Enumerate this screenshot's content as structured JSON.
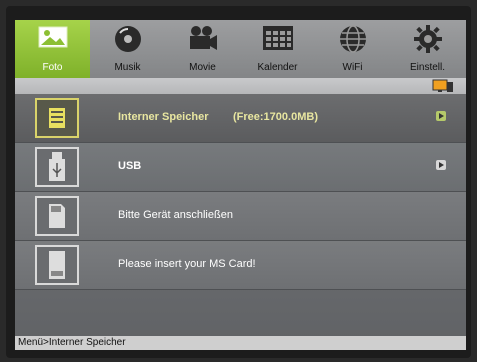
{
  "tabs": [
    {
      "label": "Foto",
      "icon": "photo-icon",
      "active": true
    },
    {
      "label": "Musik",
      "icon": "music-disc-icon"
    },
    {
      "label": "Movie",
      "icon": "movie-camera-icon"
    },
    {
      "label": "Kalender",
      "icon": "calendar-icon"
    },
    {
      "label": "WiFi",
      "icon": "globe-icon"
    },
    {
      "label": "Einstell.",
      "icon": "gear-icon"
    }
  ],
  "list": {
    "items": [
      {
        "label": "Interner Speicher",
        "free": "(Free:1700.0MB)",
        "icon": "memory-chip-icon",
        "selected": true
      },
      {
        "label": "USB",
        "icon": "usb-icon"
      },
      {
        "label": "Bitte Gerät anschließen",
        "icon": "sd-card-icon"
      },
      {
        "label": "Please insert your MS Card!",
        "icon": "ms-card-icon"
      }
    ]
  },
  "status": {
    "breadcrumb": "Menü>Interner Speicher"
  },
  "colors": {
    "active_tab": "#8cbf34",
    "selected_text": "#e8e6a0"
  }
}
